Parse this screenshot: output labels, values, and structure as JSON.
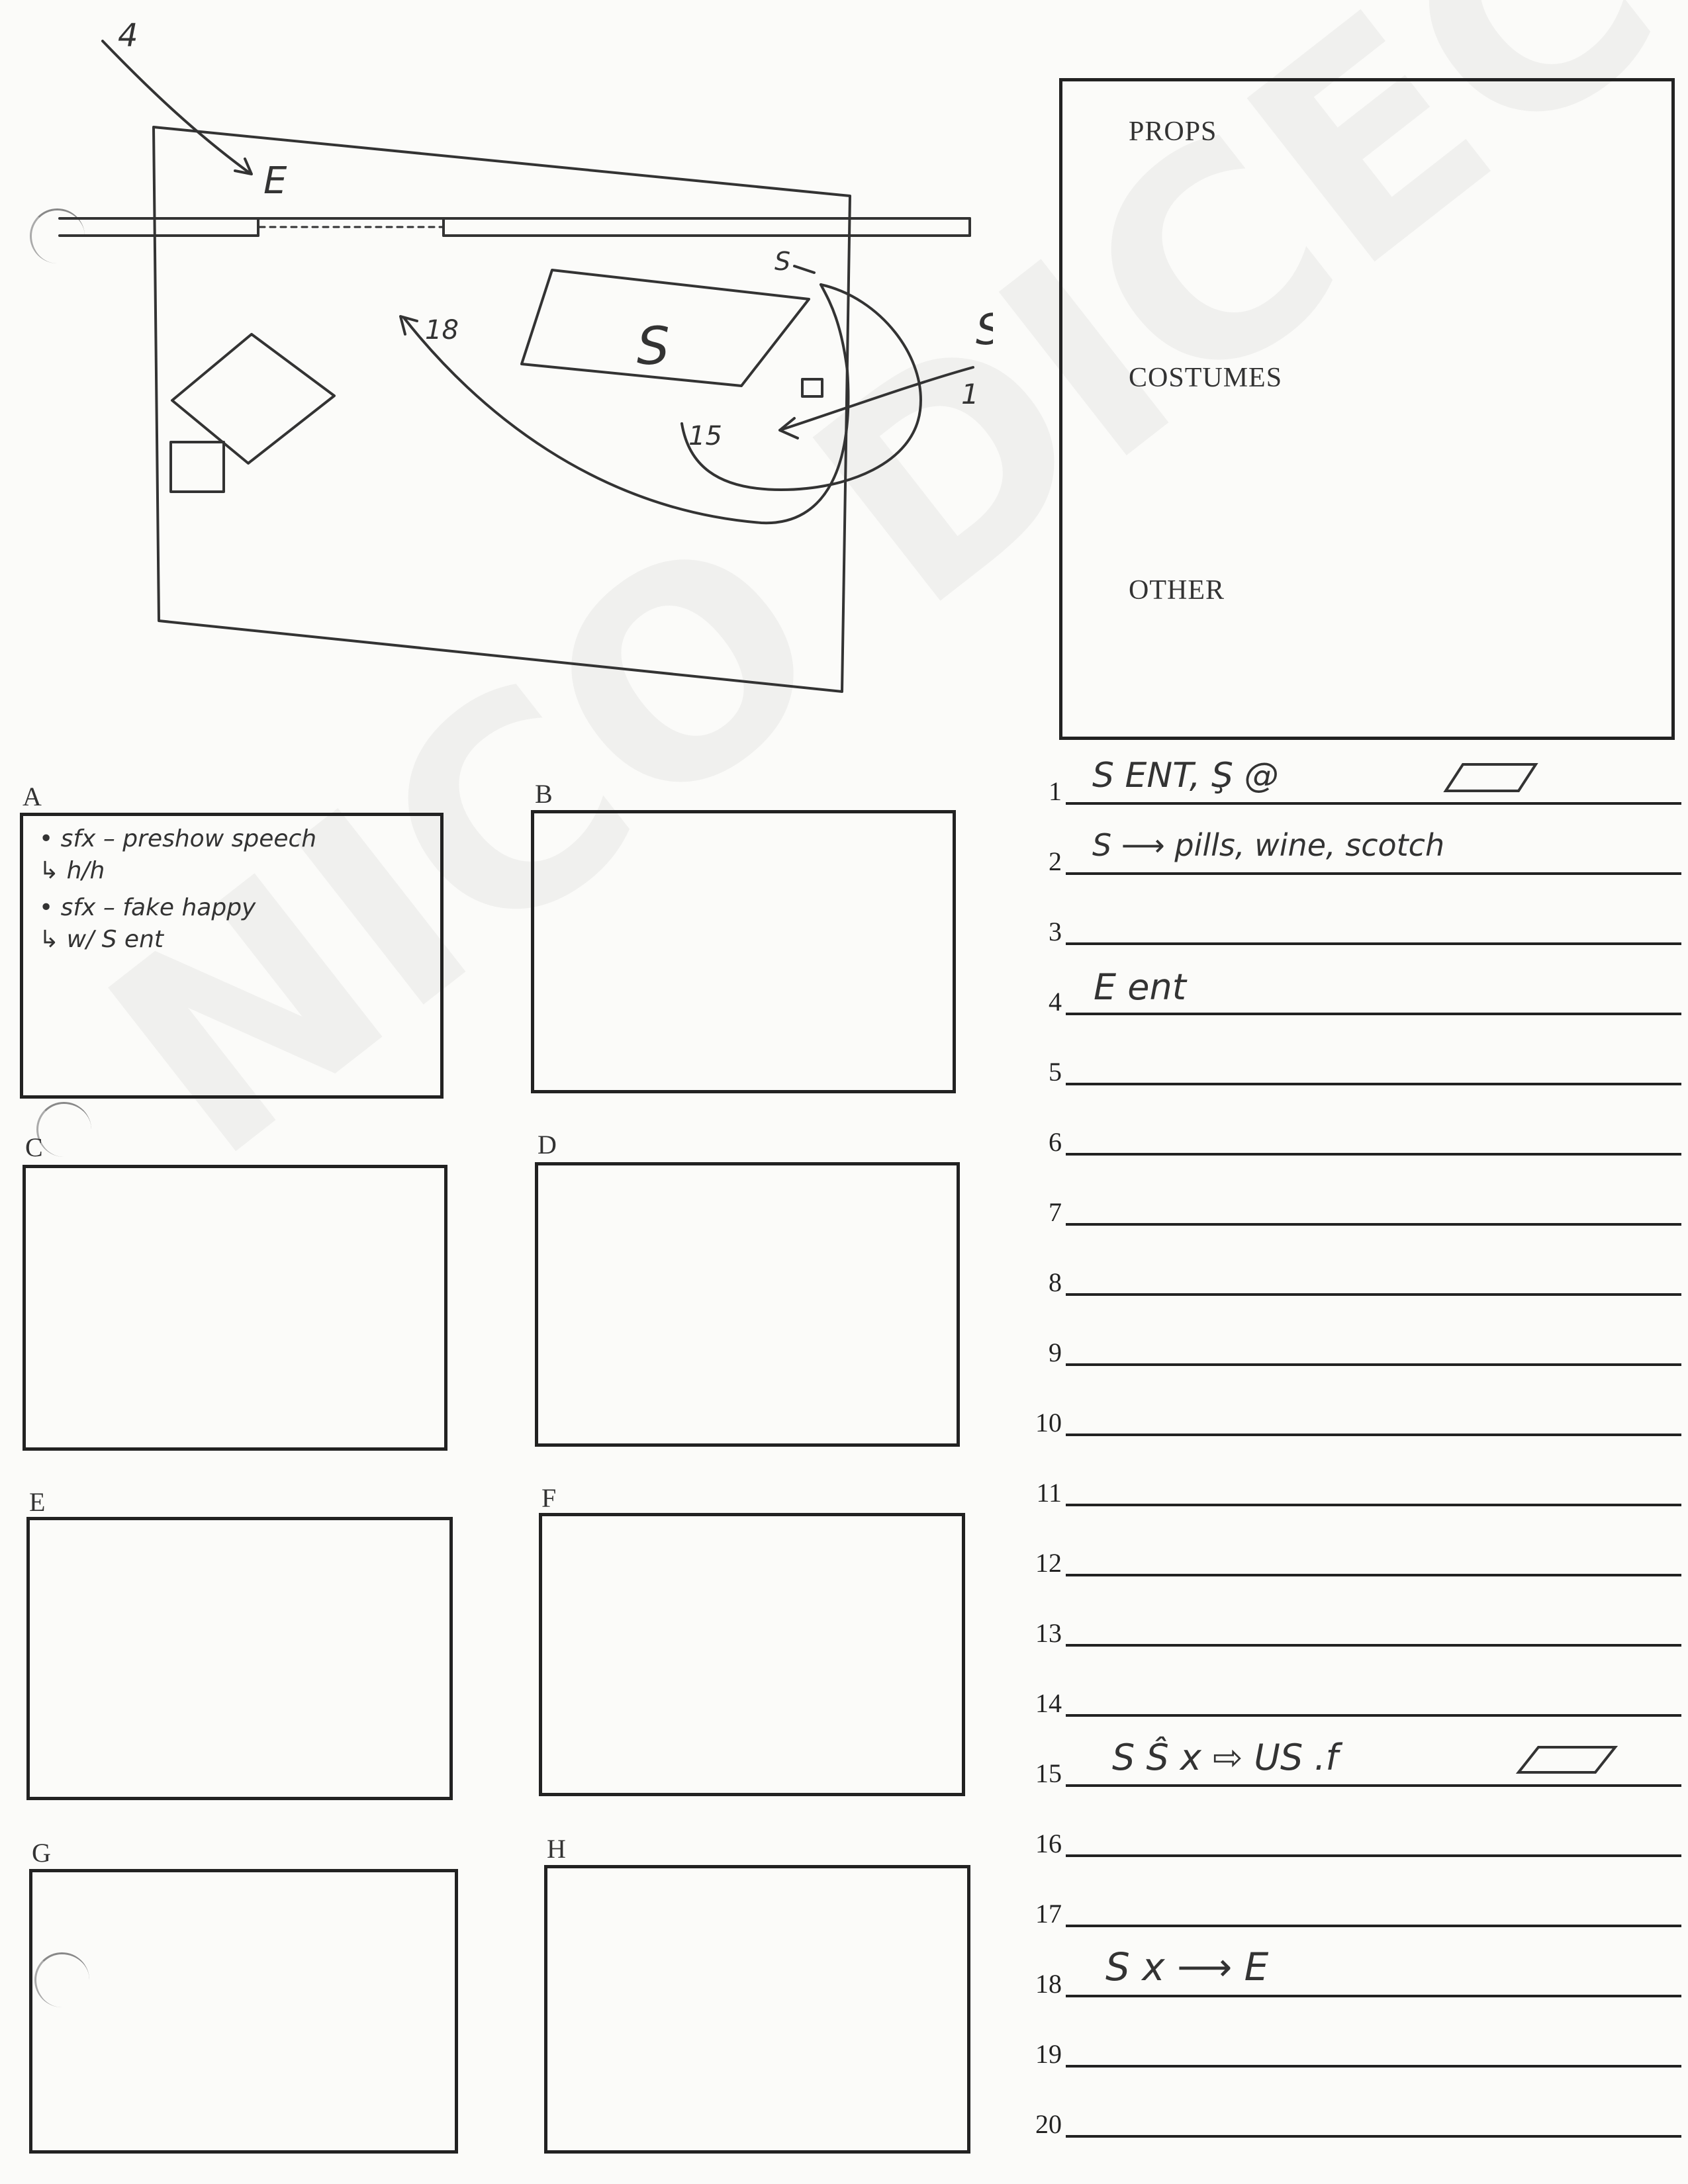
{
  "watermark": "NICO DICECCO",
  "sidebar": {
    "props_label": "PROPS",
    "costumes_label": "COSTUMES",
    "other_label": "OTHER"
  },
  "diagram": {
    "labels": {
      "entrance_4": "4",
      "e_mark": "E",
      "s_small": "S",
      "s_center": "S",
      "s_right": "S",
      "arrow_18": "18",
      "arrow_15": "15",
      "arrow_1": "1"
    }
  },
  "boxes": {
    "a": {
      "label": "A",
      "notes": [
        "• sfx  –  preshow  speech",
        "↳ h/h",
        "• sfx  –  fake  happy",
        "↳ w/   S  ent"
      ]
    },
    "b": {
      "label": "B"
    },
    "c": {
      "label": "C"
    },
    "d": {
      "label": "D"
    },
    "e": {
      "label": "E"
    },
    "f": {
      "label": "F"
    },
    "g": {
      "label": "G"
    },
    "h": {
      "label": "H"
    }
  },
  "lines": [
    {
      "num": "1",
      "text": "S  ENT,  Ş  @"
    },
    {
      "num": "2",
      "text": "S  ⟶  pills,  wine,  scotch"
    },
    {
      "num": "3",
      "text": ""
    },
    {
      "num": "4",
      "text": "E  ent"
    },
    {
      "num": "5",
      "text": ""
    },
    {
      "num": "6",
      "text": ""
    },
    {
      "num": "7",
      "text": ""
    },
    {
      "num": "8",
      "text": ""
    },
    {
      "num": "9",
      "text": ""
    },
    {
      "num": "10",
      "text": ""
    },
    {
      "num": "11",
      "text": ""
    },
    {
      "num": "12",
      "text": ""
    },
    {
      "num": "13",
      "text": ""
    },
    {
      "num": "14",
      "text": ""
    },
    {
      "num": "15",
      "text": "S Ŝ x ⇨ US .f"
    },
    {
      "num": "16",
      "text": ""
    },
    {
      "num": "17",
      "text": ""
    },
    {
      "num": "18",
      "text": "S  x ⟶  E"
    },
    {
      "num": "19",
      "text": ""
    },
    {
      "num": "20",
      "text": ""
    }
  ]
}
